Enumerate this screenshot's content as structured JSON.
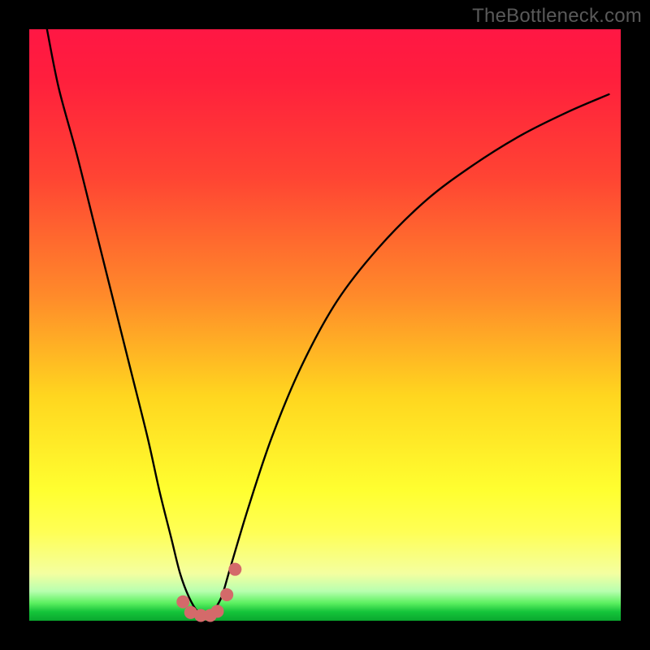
{
  "watermark": {
    "text": "TheBottleneck.com"
  },
  "chart_data": {
    "type": "line",
    "title": "",
    "xlabel": "",
    "ylabel": "",
    "xlim": [
      0,
      100
    ],
    "ylim": [
      0,
      100
    ],
    "grid": false,
    "legend": false,
    "series": [
      {
        "name": "bottleneck-curve",
        "color": "#000000",
        "x": [
          3,
          5,
          8,
          11,
          14,
          17,
          20,
          22,
          24,
          25.5,
          27,
          28.5,
          30,
          31,
          32.5,
          34,
          37,
          41,
          46,
          52,
          59,
          67,
          75,
          83,
          91,
          98
        ],
        "y": [
          100,
          90,
          79,
          67,
          55,
          43,
          31,
          22,
          14,
          8,
          4,
          1.5,
          0.7,
          1.5,
          4,
          9,
          19,
          31,
          43,
          54,
          63,
          71,
          77,
          82,
          86,
          89
        ]
      }
    ],
    "markers": [
      {
        "x": 26.0,
        "y": 3.2,
        "r": 1.1,
        "color": "#d46a6a"
      },
      {
        "x": 27.3,
        "y": 1.4,
        "r": 1.1,
        "color": "#d46a6a"
      },
      {
        "x": 29.0,
        "y": 0.9,
        "r": 1.1,
        "color": "#d46a6a"
      },
      {
        "x": 30.6,
        "y": 0.9,
        "r": 1.1,
        "color": "#d46a6a"
      },
      {
        "x": 31.8,
        "y": 1.6,
        "r": 1.1,
        "color": "#d46a6a"
      },
      {
        "x": 33.4,
        "y": 4.4,
        "r": 1.1,
        "color": "#d46a6a"
      },
      {
        "x": 34.8,
        "y": 8.7,
        "r": 1.1,
        "color": "#d46a6a"
      }
    ],
    "background_gradient": [
      {
        "stop": 0.0,
        "color": "#ff1744"
      },
      {
        "stop": 0.45,
        "color": "#ff8a2a"
      },
      {
        "stop": 0.78,
        "color": "#ffff30"
      },
      {
        "stop": 0.95,
        "color": "#b8ffb0"
      },
      {
        "stop": 1.0,
        "color": "#0aa72e"
      }
    ]
  }
}
